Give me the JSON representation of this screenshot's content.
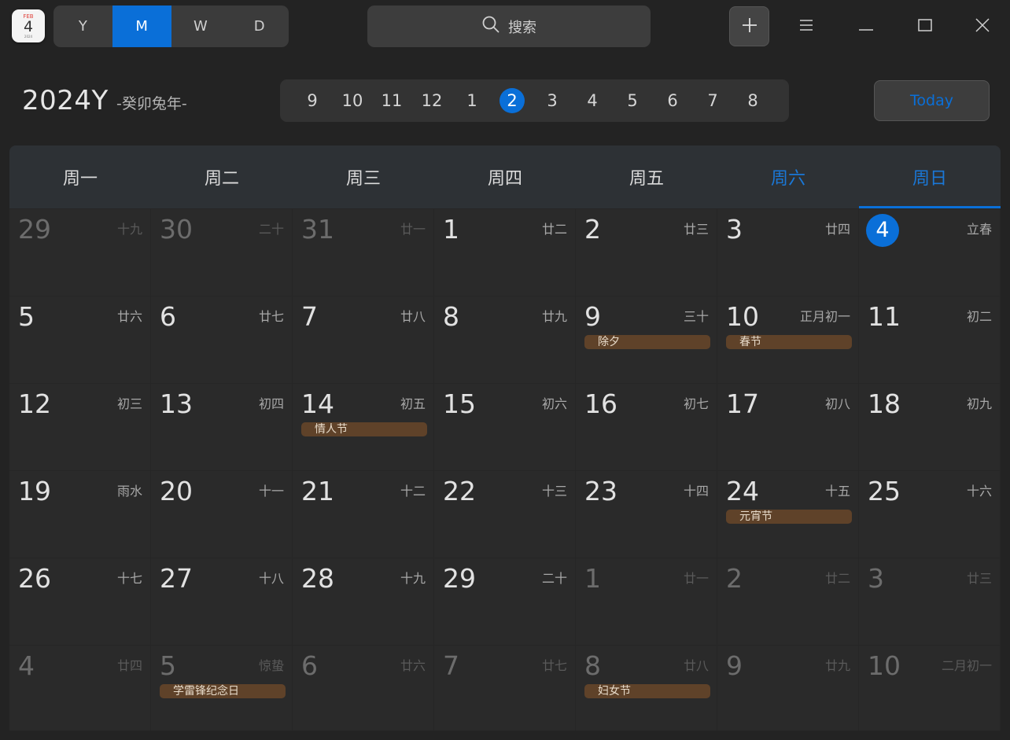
{
  "app": {
    "icon": {
      "month": "FEB",
      "day": "4",
      "year_label": "2024"
    }
  },
  "views": [
    {
      "label": "Y",
      "active": false
    },
    {
      "label": "M",
      "active": true
    },
    {
      "label": "W",
      "active": false
    },
    {
      "label": "D",
      "active": false
    }
  ],
  "search": {
    "label": "搜索"
  },
  "header": {
    "year": "2024Y",
    "lunar_year": "-癸卯兔年-",
    "today_label": "Today"
  },
  "months": [
    "9",
    "10",
    "11",
    "12",
    "1",
    "2",
    "3",
    "4",
    "5",
    "6",
    "7",
    "8"
  ],
  "active_month": "2",
  "weekdays": [
    "周一",
    "周二",
    "周三",
    "周四",
    "周五",
    "周六",
    "周日"
  ],
  "weeks": [
    [
      {
        "d": "29",
        "l": "十九",
        "other": true
      },
      {
        "d": "30",
        "l": "二十",
        "other": true
      },
      {
        "d": "31",
        "l": "廿一",
        "other": true
      },
      {
        "d": "1",
        "l": "廿二"
      },
      {
        "d": "2",
        "l": "廿三"
      },
      {
        "d": "3",
        "l": "廿四"
      },
      {
        "d": "4",
        "l": "立春",
        "today": true
      }
    ],
    [
      {
        "d": "5",
        "l": "廿六"
      },
      {
        "d": "6",
        "l": "廿七"
      },
      {
        "d": "7",
        "l": "廿八"
      },
      {
        "d": "8",
        "l": "廿九"
      },
      {
        "d": "9",
        "l": "三十",
        "e": "除夕"
      },
      {
        "d": "10",
        "l": "正月初一",
        "e": "春节"
      },
      {
        "d": "11",
        "l": "初二"
      }
    ],
    [
      {
        "d": "12",
        "l": "初三"
      },
      {
        "d": "13",
        "l": "初四"
      },
      {
        "d": "14",
        "l": "初五",
        "e": "情人节"
      },
      {
        "d": "15",
        "l": "初六"
      },
      {
        "d": "16",
        "l": "初七"
      },
      {
        "d": "17",
        "l": "初八"
      },
      {
        "d": "18",
        "l": "初九"
      }
    ],
    [
      {
        "d": "19",
        "l": "雨水"
      },
      {
        "d": "20",
        "l": "十一"
      },
      {
        "d": "21",
        "l": "十二"
      },
      {
        "d": "22",
        "l": "十三"
      },
      {
        "d": "23",
        "l": "十四"
      },
      {
        "d": "24",
        "l": "十五",
        "e": "元宵节"
      },
      {
        "d": "25",
        "l": "十六"
      }
    ],
    [
      {
        "d": "26",
        "l": "十七"
      },
      {
        "d": "27",
        "l": "十八"
      },
      {
        "d": "28",
        "l": "十九"
      },
      {
        "d": "29",
        "l": "二十"
      },
      {
        "d": "1",
        "l": "廿一",
        "other": true
      },
      {
        "d": "2",
        "l": "廿二",
        "other": true
      },
      {
        "d": "3",
        "l": "廿三",
        "other": true
      }
    ],
    [
      {
        "d": "4",
        "l": "廿四",
        "other": true
      },
      {
        "d": "5",
        "l": "惊蛰",
        "other": true,
        "e": "学雷锋纪念日"
      },
      {
        "d": "6",
        "l": "廿六",
        "other": true
      },
      {
        "d": "7",
        "l": "廿七",
        "other": true
      },
      {
        "d": "8",
        "l": "廿八",
        "other": true,
        "e": "妇女节"
      },
      {
        "d": "9",
        "l": "廿九",
        "other": true
      },
      {
        "d": "10",
        "l": "二月初一",
        "other": true
      }
    ]
  ],
  "colors": {
    "accent": "#0a6fd8",
    "event_bg": "#5f4229",
    "background": "#232323"
  }
}
